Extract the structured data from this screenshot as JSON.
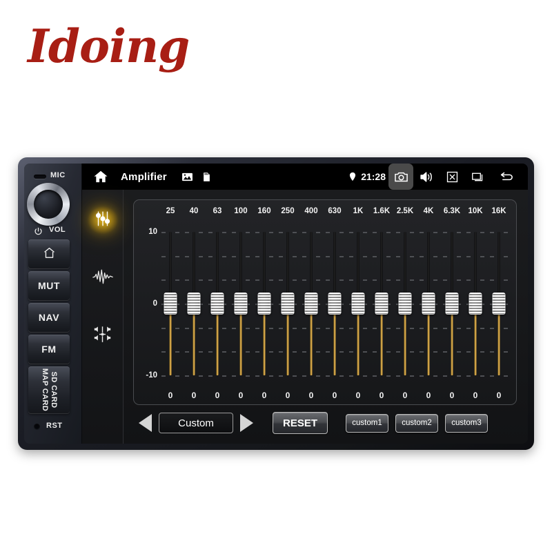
{
  "brand": {
    "logo": "Idoing"
  },
  "device": {
    "mic_label": "MIC",
    "vol_label": "VOL",
    "power_icon": "power-icon",
    "buttons": [
      {
        "name": "home",
        "label": "",
        "icon": "home-icon"
      },
      {
        "name": "mute",
        "label": "MUT",
        "icon": ""
      },
      {
        "name": "nav",
        "label": "NAV",
        "icon": ""
      },
      {
        "name": "fm",
        "label": "FM",
        "icon": ""
      }
    ],
    "card_slot": {
      "line1": "SD CARD",
      "line2": "MAP CARD"
    },
    "reset_label": "RST"
  },
  "statusbar": {
    "home_icon": "home-icon",
    "title": "Amplifier",
    "picture_icon": "picture-icon",
    "sdcard_icon": "sd-card-icon",
    "location_icon": "location-pin-icon",
    "time": "21:28",
    "camera_icon": "camera-icon",
    "volume_icon": "speaker-icon",
    "close_icon": "close-box-icon",
    "recents_icon": "recents-icon",
    "back_icon": "back-arrow-icon"
  },
  "rail": {
    "items": [
      {
        "name": "equalizer",
        "icon": "equalizer-sliders-icon",
        "active": true
      },
      {
        "name": "sound-effect",
        "icon": "waveform-icon",
        "active": false
      },
      {
        "name": "balance-fader",
        "icon": "balance-fader-icon",
        "active": false
      }
    ]
  },
  "equalizer": {
    "scale": {
      "max": "10",
      "mid": "0",
      "min": "-10"
    },
    "bands": [
      {
        "freq": "25",
        "value": "0"
      },
      {
        "freq": "40",
        "value": "0"
      },
      {
        "freq": "63",
        "value": "0"
      },
      {
        "freq": "100",
        "value": "0"
      },
      {
        "freq": "160",
        "value": "0"
      },
      {
        "freq": "250",
        "value": "0"
      },
      {
        "freq": "400",
        "value": "0"
      },
      {
        "freq": "630",
        "value": "0"
      },
      {
        "freq": "1K",
        "value": "0"
      },
      {
        "freq": "1.6K",
        "value": "0"
      },
      {
        "freq": "2.5K",
        "value": "0"
      },
      {
        "freq": "4K",
        "value": "0"
      },
      {
        "freq": "6.3K",
        "value": "0"
      },
      {
        "freq": "10K",
        "value": "0"
      },
      {
        "freq": "16K",
        "value": "0"
      }
    ]
  },
  "controls": {
    "prev_icon": "triangle-left-icon",
    "preset_name": "Custom",
    "next_icon": "triangle-right-icon",
    "reset_label": "RESET",
    "presets": [
      {
        "label": "custom1"
      },
      {
        "label": "custom2"
      },
      {
        "label": "custom3"
      }
    ]
  },
  "colors": {
    "accent_amber": "#e0b255",
    "brand_red": "#a81e14",
    "glow_yellow": "#f0c020"
  }
}
